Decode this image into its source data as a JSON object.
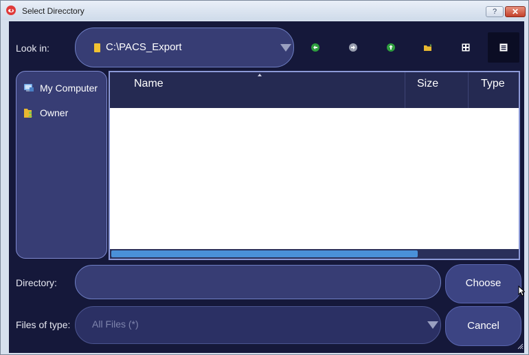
{
  "window": {
    "title": "Select Direcctory",
    "help_label": "?",
    "close_label": "✕"
  },
  "toolbar": {
    "look_in_label": "Look in:",
    "path_value": "C:\\PACS_Export",
    "tools": [
      "back-icon",
      "forward-icon",
      "up-icon",
      "new-folder-icon",
      "list-view-icon",
      "detail-view-icon"
    ]
  },
  "places": [
    {
      "label": "My Computer",
      "icon": "computer-icon"
    },
    {
      "label": "Owner",
      "icon": "user-folder-icon"
    }
  ],
  "file_list": {
    "columns": [
      "Name",
      "Size",
      "Type"
    ],
    "rows": []
  },
  "directory": {
    "label": "Directory:",
    "value": ""
  },
  "file_type": {
    "label": "Files of type:",
    "value": "All Files (*)"
  },
  "buttons": {
    "choose": "Choose",
    "cancel": "Cancel"
  },
  "colors": {
    "background": "#15183a",
    "field": "#373d74",
    "accent": "#4a90d9",
    "button": "#3c4483"
  }
}
